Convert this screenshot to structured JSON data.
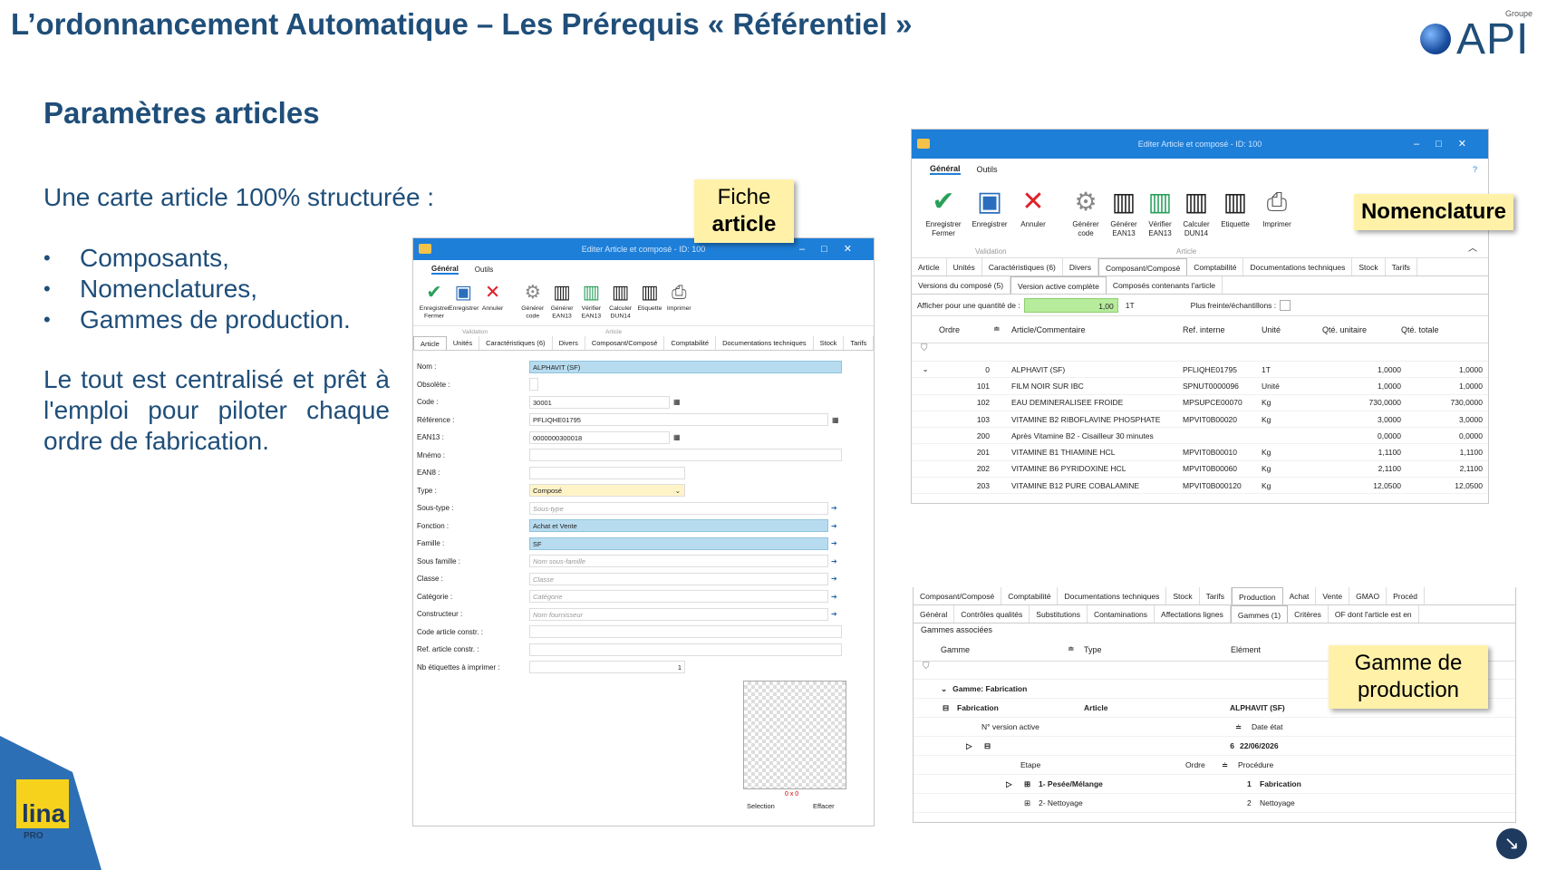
{
  "slide": {
    "title": "L’ordonnancement Automatique – Les Prérequis « Référentiel »",
    "subtitle": "Paramètres articles",
    "lead": "Une carte article 100% structurée :",
    "bullets": [
      "Composants,",
      "Nomenclatures,",
      "Gammes de production."
    ],
    "paragraph": "Le tout est centralisé et prêt à l'emploi pour piloter chaque ordre de fabrication."
  },
  "logos": {
    "api": "API",
    "api_group": "Groupe",
    "lina": "lina",
    "lina_sub": "PRO"
  },
  "callouts": {
    "fiche_line1": "Fiche",
    "fiche_line2": "article",
    "nomenclature": "Nomenclature",
    "gamme_line1": "Gamme de",
    "gamme_line2": "production"
  },
  "common": {
    "window_title": "Editer Article et composé - ID: 100",
    "menu_general": "Général",
    "menu_outils": "Outils",
    "btn_save_close_1": "Enregistrer",
    "btn_save_close_2": "Fermer",
    "btn_save": "Enregistrer",
    "btn_cancel": "Annuler",
    "btn_gen_code_1": "Générer",
    "btn_gen_code_2": "code",
    "btn_gen_ean_1": "Générer",
    "btn_gen_ean_2": "EAN13",
    "btn_check_ean_1": "Vérifier",
    "btn_check_ean_2": "EAN13",
    "btn_calc_dun_1": "Calculer",
    "btn_calc_dun_2": "DUN14",
    "btn_label": "Etiquette",
    "btn_print": "Imprimer",
    "group_validation": "Validation",
    "group_article": "Article"
  },
  "fiche": {
    "tabs": [
      "Article",
      "Unités",
      "Caractéristiques (6)",
      "Divers",
      "Composant/Composé",
      "Comptabilité",
      "Documentations techniques",
      "Stock",
      "Tarifs"
    ],
    "fields": [
      {
        "label": "Nom :",
        "value": "ALPHAVIT (SF)"
      },
      {
        "label": "Obsolète :",
        "value": ""
      },
      {
        "label": "Code :",
        "value": "30001"
      },
      {
        "label": "Référence :",
        "value": "PFLIQHE01795"
      },
      {
        "label": "EAN13 :",
        "value": "0000000300018"
      },
      {
        "label": "Mnémo :",
        "value": ""
      },
      {
        "label": "EAN8 :",
        "value": ""
      },
      {
        "label": "Type :",
        "value": "Composé"
      },
      {
        "label": "Sous-type :",
        "value": "Sous-type"
      },
      {
        "label": "Fonction :",
        "value": "Achat et Vente"
      },
      {
        "label": "Famille :",
        "value": "SF"
      },
      {
        "label": "Sous famille :",
        "value": "Nom sous-famille"
      },
      {
        "label": "Classe :",
        "value": "Classe"
      },
      {
        "label": "Catégorie :",
        "value": "Catégorie"
      },
      {
        "label": "Constructeur :",
        "value": "Nom fournisseur"
      },
      {
        "label": "Code article constr. :",
        "value": ""
      },
      {
        "label": "Ref. article constr. :",
        "value": ""
      },
      {
        "label": "Nb étiquettes à imprimer :",
        "value": "1"
      }
    ],
    "image_size": "0 x 0",
    "btn_selection": "Selection",
    "btn_effacer": "Effacer"
  },
  "nomenclature": {
    "tabs": [
      "Article",
      "Unités",
      "Caractéristiques (6)",
      "Divers",
      "Composant/Composé",
      "Comptabilité",
      "Documentations techniques",
      "Stock",
      "Tarifs"
    ],
    "subtabs": [
      "Versions du composé (5)",
      "Version active complète",
      "Composés contenants l'article"
    ],
    "qty_label": "Afficher pour une quantité de :",
    "qty_value": "1,00",
    "qty_unit": "1T",
    "plus_freinte": "Plus freinte/échantillons :",
    "headers": [
      "Ordre",
      "Article/Commentaire",
      "Ref. interne",
      "Unité",
      "Qté. unitaire",
      "Qté. totale"
    ],
    "rows": [
      [
        "0",
        "ALPHAVIT (SF)",
        "PFLIQHE01795",
        "1T",
        "1,0000",
        "1,0000"
      ],
      [
        "101",
        "FILM NOIR SUR IBC",
        "SPNUT0000096",
        "Unité",
        "1,0000",
        "1,0000"
      ],
      [
        "102",
        "EAU DEMINERALISEE FROIDE",
        "MPSUPCE00070",
        "Kg",
        "730,0000",
        "730,0000"
      ],
      [
        "103",
        "VITAMINE B2 RIBOFLAVINE PHOSPHATE",
        "MPVIT0B00020",
        "Kg",
        "3,0000",
        "3,0000"
      ],
      [
        "200",
        "Après Vitamine B2 - Cisailleur 30 minutes",
        "",
        "",
        "0,0000",
        "0,0000"
      ],
      [
        "201",
        "VITAMINE B1 THIAMINE HCL",
        "MPVIT0B00010",
        "Kg",
        "1,1100",
        "1,1100"
      ],
      [
        "202",
        "VITAMINE B6 PYRIDOXINE HCL",
        "MPVIT0B00060",
        "Kg",
        "2,1100",
        "2,1100"
      ],
      [
        "203",
        "VITAMINE B12 PURE COBALAMINE",
        "MPVIT0B000120",
        "Kg",
        "12,0500",
        "12,0500"
      ]
    ]
  },
  "gamme": {
    "tabs1": [
      "Composant/Composé",
      "Comptabilité",
      "Documentations techniques",
      "Stock",
      "Tarifs",
      "Production",
      "Achat",
      "Vente",
      "GMAO",
      "Procéd"
    ],
    "tabs2": [
      "Général",
      "Contrôles qualités",
      "Substitutions",
      "Contaminations",
      "Affectations lignes",
      "Gammes (1)",
      "Critères",
      "OF dont l'article est en"
    ],
    "section": "Gammes associées",
    "h_gamme": "Gamme",
    "h_type": "Type",
    "h_element": "Elément",
    "group": "Gamme: Fabrication",
    "r_gamme": "Fabrication",
    "r_type": "Article",
    "r_element": "ALPHAVIT (SF)",
    "h_version": "N° version active",
    "h_date": "Date état",
    "v_num": "6",
    "v_date": "22/06/2026",
    "h_etape": "Etape",
    "h_ordre": "Ordre",
    "h_proc": "Procédure",
    "steps": [
      {
        "etape": "1- Pesée/Mélange",
        "ordre": "1",
        "proc": "Fabrication"
      },
      {
        "etape": "2- Nettoyage",
        "ordre": "2",
        "proc": "Nettoyage"
      }
    ]
  }
}
